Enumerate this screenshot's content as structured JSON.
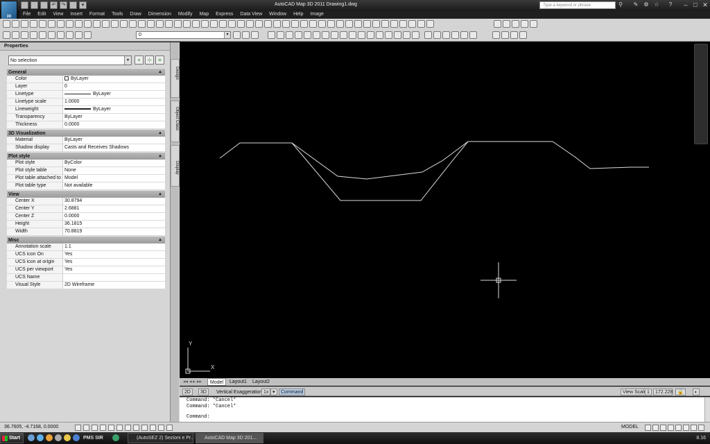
{
  "window": {
    "title": "AutoCAD Map 3D 2011   Drawing1.dwg",
    "search_placeholder": "Type a keyword or phrase",
    "logo_text": "3D"
  },
  "menu": [
    "File",
    "Edit",
    "View",
    "Insert",
    "Format",
    "Tools",
    "Draw",
    "Dimension",
    "Modify",
    "Map",
    "Express",
    "Data View",
    "Window",
    "Help",
    "Image"
  ],
  "toolbar": {
    "layer_value": "0"
  },
  "properties": {
    "title": "Properties",
    "selection": "No selection",
    "sections": [
      {
        "name": "General",
        "rows": [
          {
            "k": "Color",
            "v": "ByLayer",
            "sw": "sq"
          },
          {
            "k": "Layer",
            "v": "0"
          },
          {
            "k": "Linetype",
            "v": "ByLayer",
            "sw": "line"
          },
          {
            "k": "Linetype scale",
            "v": "1.0000"
          },
          {
            "k": "Lineweight",
            "v": "ByLayer",
            "sw": "linew"
          },
          {
            "k": "Transparency",
            "v": "ByLayer"
          },
          {
            "k": "Thickness",
            "v": "0.0000"
          }
        ]
      },
      {
        "name": "3D Visualization",
        "rows": [
          {
            "k": "Material",
            "v": "ByLayer"
          },
          {
            "k": "Shadow display",
            "v": "Casts and Receives Shadows"
          }
        ]
      },
      {
        "name": "Plot style",
        "rows": [
          {
            "k": "Plot style",
            "v": "ByColor"
          },
          {
            "k": "Plot style table",
            "v": "None"
          },
          {
            "k": "Plot table attached to",
            "v": "Model"
          },
          {
            "k": "Plot table type",
            "v": "Not available"
          }
        ]
      },
      {
        "name": "View",
        "rows": [
          {
            "k": "Center X",
            "v": "30.8794"
          },
          {
            "k": "Center Y",
            "v": "2.6881"
          },
          {
            "k": "Center Z",
            "v": "0.0000"
          },
          {
            "k": "Height",
            "v": "36.1815"
          },
          {
            "k": "Width",
            "v": "70.8819"
          }
        ]
      },
      {
        "name": "Misc",
        "rows": [
          {
            "k": "Annotation scale",
            "v": "1:1"
          },
          {
            "k": "UCS icon On",
            "v": "Yes"
          },
          {
            "k": "UCS icon at origin",
            "v": "Yes"
          },
          {
            "k": "UCS per viewport",
            "v": "Yes"
          },
          {
            "k": "UCS Name",
            "v": ""
          },
          {
            "k": "Visual Style",
            "v": "2D Wireframe"
          }
        ]
      }
    ],
    "side_tabs": [
      "Design",
      "Object Class",
      "Display"
    ]
  },
  "viewport": {
    "ucs_y": "Y",
    "ucs_x": "X"
  },
  "layout_tabs": [
    "Model",
    "Layout1",
    "Layout2"
  ],
  "cmdbar": {
    "b2d": "2D",
    "b3d": "3D",
    "ve_label": "Vertical Exaggeration:",
    "ve_value": "1x",
    "command": "Command",
    "view_scale_label": "View Scale",
    "view_scale_value": "1",
    "zoom_value": "172.228"
  },
  "command_lines": [
    "Command: *Cancel*",
    "Command: *Cancel*",
    "Command:"
  ],
  "status": {
    "coords": "36.7605, -4.7168, 0.0000",
    "model": "MODEL"
  },
  "taskbar": {
    "start": "Start",
    "tasks": [
      "(AutoSEZ 2) Sezioni e Pr...",
      "AutoCAD Map 3D 201..."
    ],
    "clock": "8.16",
    "quick_text": "PMS SIR"
  }
}
